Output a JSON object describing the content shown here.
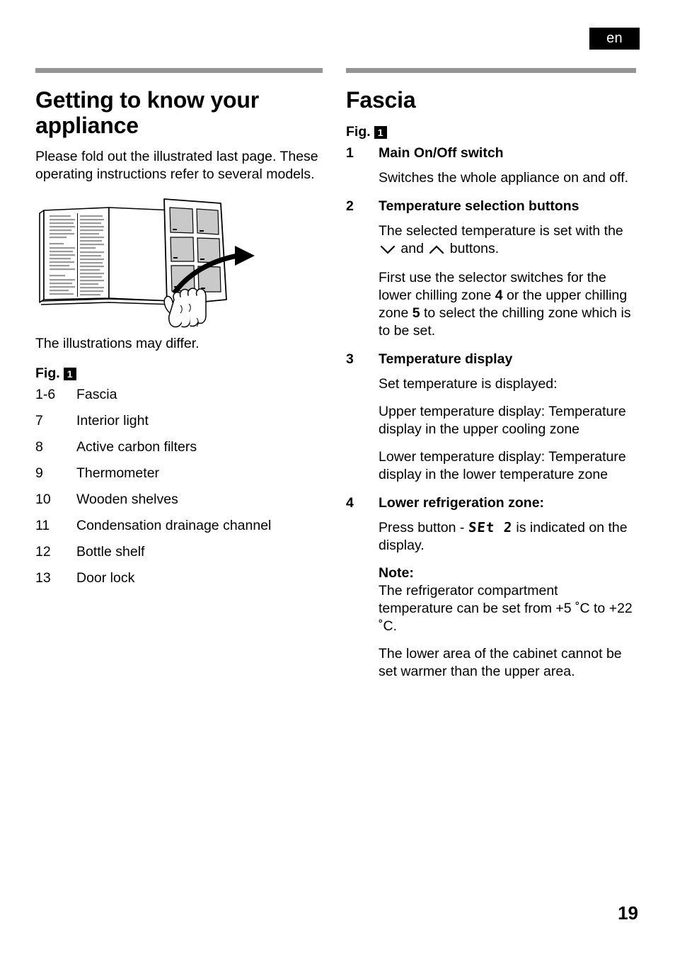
{
  "language_badge": "en",
  "page_number": "19",
  "left_column": {
    "heading": "Getting to know your appliance",
    "intro": "Please fold out the illustrated last page. These operating instructions refer to several models.",
    "illustration_caption": "The illustrations may differ.",
    "figure_label": "Fig.",
    "figure_number": "1",
    "parts": [
      {
        "num": "1-6",
        "label": "Fascia"
      },
      {
        "num": "7",
        "label": "Interior light"
      },
      {
        "num": "8",
        "label": "Active carbon filters"
      },
      {
        "num": "9",
        "label": "Thermometer"
      },
      {
        "num": "10",
        "label": "Wooden shelves"
      },
      {
        "num": "11",
        "label": "Condensation drainage channel"
      },
      {
        "num": "12",
        "label": "Bottle shelf"
      },
      {
        "num": "13",
        "label": "Door lock"
      }
    ]
  },
  "right_column": {
    "heading": "Fascia",
    "figure_label": "Fig.",
    "figure_number": "1",
    "features": [
      {
        "num": "1",
        "title": "Main On/Off switch",
        "paragraphs": [
          "Switches the whole appliance on and off."
        ]
      },
      {
        "num": "2",
        "title": "Temperature selection buttons",
        "para_2a_pre": "The selected temperature is set with the ",
        "para_2a_mid": " and ",
        "para_2a_post": " buttons.",
        "para_2b_pre": "First use the selector switches for the lower chilling zone ",
        "para_2b_b1": "4",
        "para_2b_mid": " or the upper chilling zone ",
        "para_2b_b2": "5",
        "para_2b_post": " to select the chilling zone which is to be set."
      },
      {
        "num": "3",
        "title": "Temperature display",
        "paragraphs": [
          "Set temperature is displayed:",
          "Upper temperature display: Temperature display in the upper cooling zone",
          "Lower temperature display: Temperature display in the lower temperature zone"
        ]
      },
      {
        "num": "4",
        "title": "Lower refrigeration zone:",
        "press_pre": "Press button - ",
        "press_lcd": "SEt 2",
        "press_post": " is indicated on the display.",
        "note_label": "Note:",
        "note_text": "The refrigerator compartment temperature can be set from +5 ˚C to +22 ˚C.",
        "closing_text": "The lower area of the cabinet cannot be set warmer than the upper area."
      }
    ]
  },
  "icons": {
    "down_chevron": "down-chevron-icon",
    "up_chevron": "up-chevron-icon",
    "fold_out_illustration": "manual-fold-out-illustration"
  },
  "colors": {
    "rule_gray": "#949494",
    "badge_bg": "#000000",
    "panel_gray": "#c9c9c9"
  }
}
